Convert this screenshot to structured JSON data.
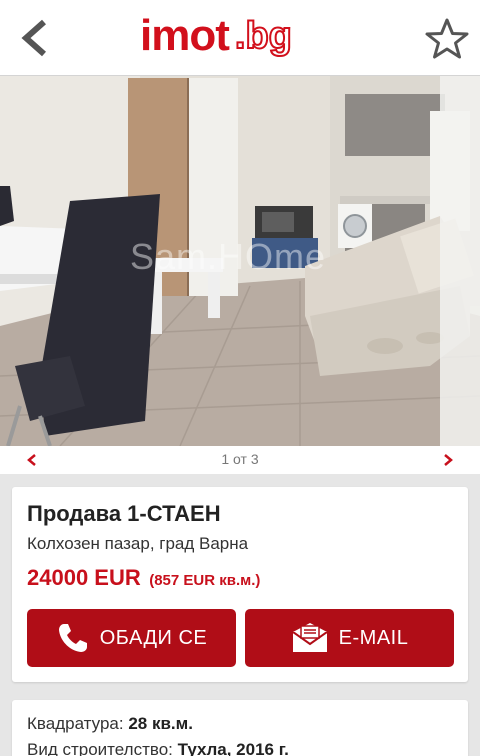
{
  "header": {
    "back_icon": "chevron-left-icon",
    "logo_main": "imot",
    "logo_tld": ".bg",
    "favorite_icon": "star-outline-icon",
    "accent_color": "#d2101c"
  },
  "photo": {
    "watermark": "Sam.HOme"
  },
  "pager": {
    "prev_icon": "chevron-left-icon",
    "next_icon": "chevron-right-icon",
    "counter": "1 от 3"
  },
  "listing": {
    "title": "Продава 1-СТАЕН",
    "location": "Колхозен пазар, град Варна",
    "price": "24000 EUR",
    "price_per_sqm": "(857 EUR кв.м.)",
    "call_label": "ОБАДИ СЕ",
    "call_icon": "phone-icon",
    "email_label": "E-MAIL",
    "email_icon": "envelope-icon",
    "button_color": "#b00d17"
  },
  "details": {
    "area_label": "Квадратура:",
    "area_value": "28 кв.м.",
    "construction_label": "Вид строителство:",
    "construction_value": "Тухла, 2016 г."
  }
}
